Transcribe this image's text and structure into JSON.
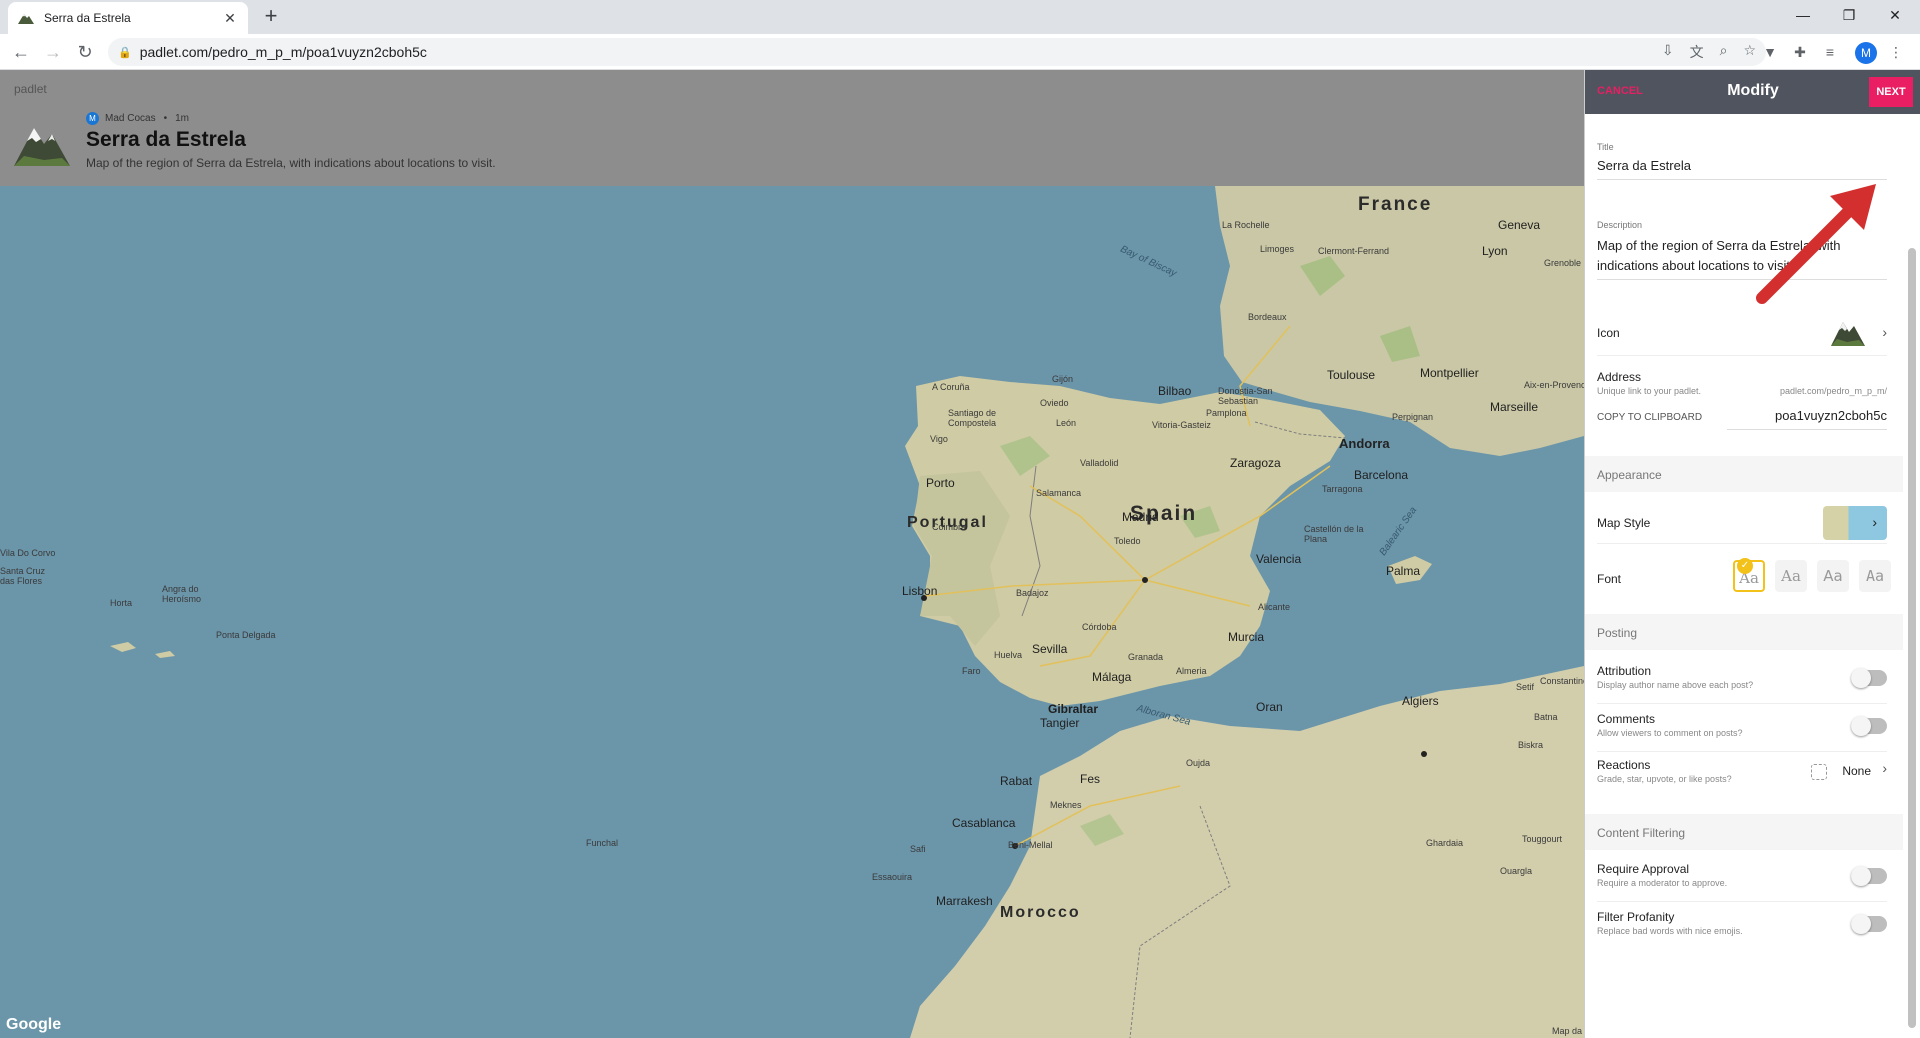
{
  "browser": {
    "tab_title": "Serra da Estrela",
    "url": "padlet.com/pedro_m_p_m/poa1vuyzn2cboh5c",
    "profile_initial": "M"
  },
  "header": {
    "brand": "padlet",
    "author": "Mad Cocas",
    "author_initial": "M",
    "time": "1m",
    "title": "Serra da Estrela",
    "description": "Map of the region of Serra da Estrela, with indications about locations to visit."
  },
  "map": {
    "countries": [
      "France",
      "Spain",
      "Portugal",
      "Morocco",
      "Andorra"
    ],
    "cities": [
      "La Rochelle",
      "Limoges",
      "Clermont-Ferrand",
      "Lyon",
      "Geneva",
      "Grenoble",
      "Bordeaux",
      "Toulouse",
      "Montpellier",
      "Aix-en-Provence",
      "Marseille",
      "Perpignan",
      "A Coruña",
      "Gijón",
      "Oviedo",
      "Santiago de Compostela",
      "León",
      "Bilbao",
      "Donostia-San Sebastian",
      "Pamplona",
      "Vitoria-Gasteiz",
      "Vigo",
      "Valladolid",
      "Zaragoza",
      "Barcelona",
      "Tarragona",
      "Porto",
      "Salamanca",
      "Madrid",
      "Toledo",
      "Coimbra",
      "Castellón de la Plana",
      "Valencia",
      "Palma",
      "Lisbon",
      "Badajoz",
      "Alicante",
      "Córdoba",
      "Murcia",
      "Sevilla",
      "Huelva",
      "Granada",
      "Almeria",
      "Faro",
      "Málaga",
      "Algiers",
      "Gibraltar",
      "Tangier",
      "Oran",
      "Rabat",
      "Fes",
      "Oujda",
      "Meknes",
      "Casablanca",
      "Beni-Mellal",
      "Safi",
      "Essaouira",
      "Marrakesh",
      "Ghardaia",
      "Touggourt",
      "Ouargla",
      "Biskra",
      "Batna",
      "Setif",
      "Constantine",
      "Funchal",
      "Ponta Delgada",
      "Angra do Heroísmo",
      "Horta",
      "Vila Do Corvo",
      "Santa Cruz das Flores"
    ],
    "seas": [
      "Bay of Biscay",
      "Balearic Sea",
      "Alboran Sea"
    ],
    "attribution": "Google",
    "scale": "Map da"
  },
  "panel": {
    "cancel": "CANCEL",
    "heading": "Modify",
    "next": "NEXT",
    "title_label": "Title",
    "title_value": "Serra da Estrela",
    "description_label": "Description",
    "description_value": " Map of the region of Serra da Estrela, with indications about locations to visit.",
    "icon_label": "Icon",
    "address_label": "Address",
    "address_sub": "Unique link to your padlet.",
    "address_prefix": "padlet.com/pedro_m_p_m/",
    "copy_label": "COPY TO CLIPBOARD",
    "address_value": "poa1vuyzn2cboh5c",
    "appearance": "Appearance",
    "map_style": "Map Style",
    "font_label": "Font",
    "font_options": [
      "Aa",
      "Aa",
      "Aa",
      "Aa"
    ],
    "posting": "Posting",
    "attribution": "Attribution",
    "attribution_sub": "Display author name above each post?",
    "comments": "Comments",
    "comments_sub": "Allow viewers to comment on posts?",
    "reactions": "Reactions",
    "reactions_sub": "Grade, star, upvote, or like posts?",
    "reactions_value": "None",
    "content_filtering": "Content Filtering",
    "require_approval": "Require Approval",
    "require_approval_sub": "Require a moderator to approve.",
    "filter_profanity": "Filter Profanity",
    "filter_profanity_sub": "Replace bad words with nice emojis.",
    "accent": "#e91e63"
  }
}
